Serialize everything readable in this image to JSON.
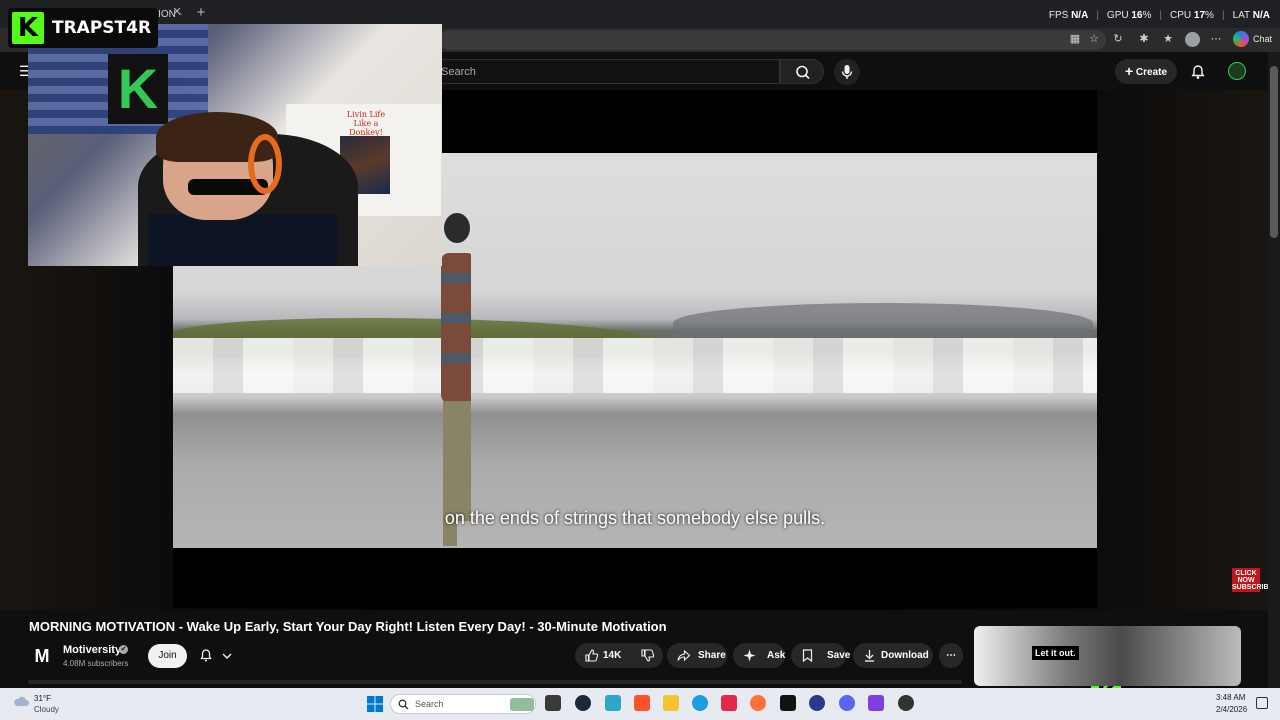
{
  "browser": {
    "tab_title": "MORNING MOTIVATION - Wa",
    "tab_close": "✕",
    "new_tab": "+",
    "chat_label": "Chat"
  },
  "stats": {
    "fps_label": "FPS",
    "fps_value": "N/A",
    "gpu_label": "GPU",
    "gpu_value": "16",
    "cpu_label": "CPU",
    "cpu_value": "17",
    "lat_label": "LAT",
    "lat_value": "N/A",
    "percent_sign": "%"
  },
  "youtube_header": {
    "search_placeholder": "Search",
    "create_label": "Create"
  },
  "player": {
    "caption": "on the ends of strings that somebody else pulls.",
    "click_now_badge": "CLICK NOW SUBSCRIBE"
  },
  "webcam": {
    "sign_text": "Livin Life Like a Donkey!"
  },
  "brand": {
    "logo_letter": "K",
    "streamer_name": "TRAPST4R"
  },
  "video_info": {
    "title": "MORNING MOTIVATION - Wake Up Early, Start Your Day Right! Listen Every Day! - 30-Minute Motivation",
    "channel_logo_letter": "M",
    "channel_name": "Motiversity",
    "verified_mark": "✔",
    "subscribers": "4.08M subscribers",
    "join_label": "Join",
    "like_count": "14K",
    "share_label": "Share",
    "ask_label": "Ask",
    "save_label": "Save",
    "download_label": "Download",
    "more_label": "⋯"
  },
  "recommendation": {
    "thumbnail_caption": "Let it out."
  },
  "taskbar": {
    "weather_temp": "31°F",
    "weather_desc": "Cloudy",
    "search_placeholder": "Search",
    "time": "3:48 AM",
    "date": "2/4/2026"
  },
  "colors": {
    "kick_green": "#53fc18",
    "youtube_dark": "#0f0f0f",
    "button_dark": "#272727",
    "headset_orange": "#e56b1f"
  }
}
